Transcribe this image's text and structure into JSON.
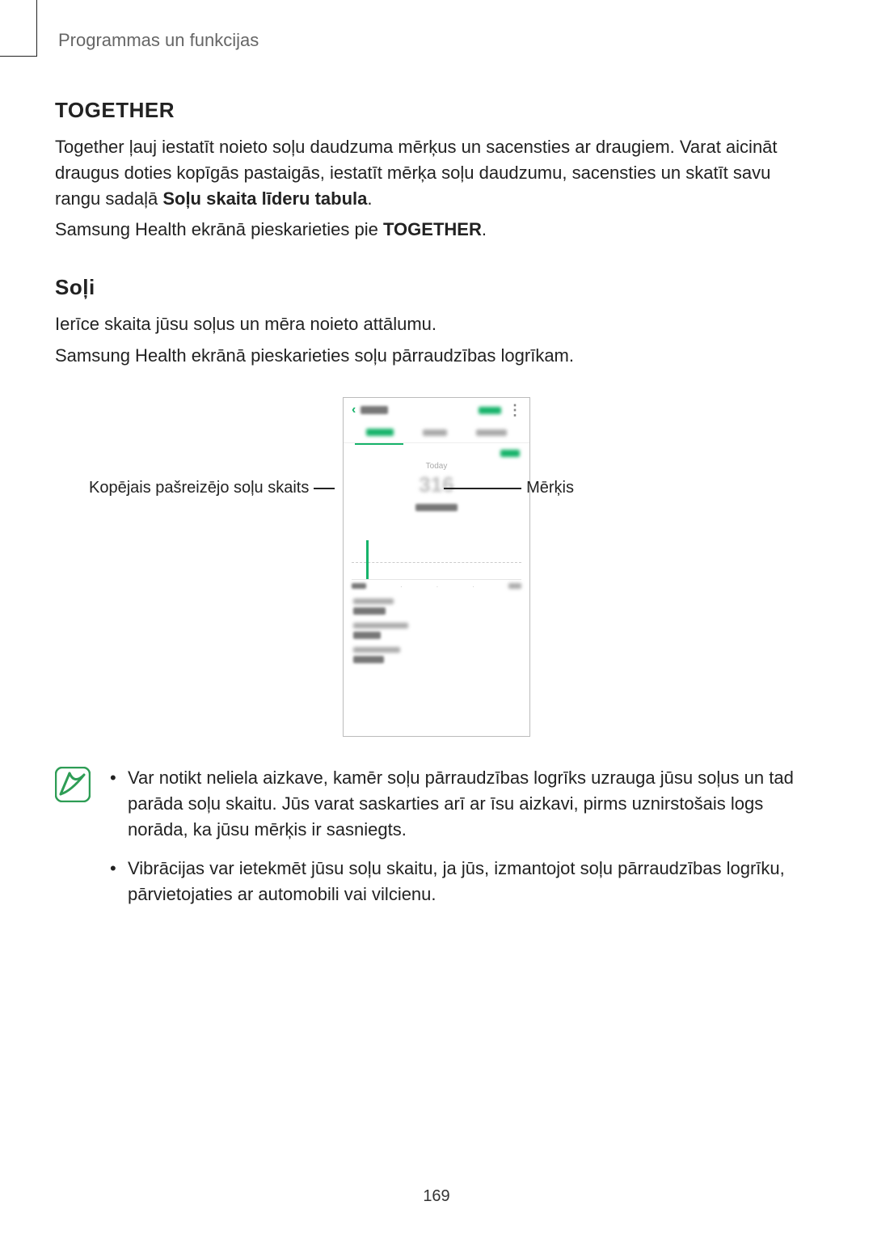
{
  "header": {
    "chapter": "Programmas un funkcijas"
  },
  "together": {
    "title": "TOGETHER",
    "para_prefix": "Together ļauj iestatīt noieto soļu daudzuma mērķus un sacensties ar draugiem. Varat aicināt draugus doties kopīgās pastaigās, iestatīt mērķa soļu daudzumu, sacensties un skatīt savu rangu sadaļā ",
    "para_bold": "Soļu skaita līderu tabula",
    "para_suffix": ".",
    "instr_prefix": "Samsung Health ekrānā pieskarieties pie ",
    "instr_bold": "TOGETHER",
    "instr_suffix": "."
  },
  "steps": {
    "title": "Soļi",
    "para1": "Ierīce skaita jūsu soļus un mēra noieto attālumu.",
    "para2": "Samsung Health ekrānā pieskarieties soļu pārraudzības logrīkam."
  },
  "callouts": {
    "left": "Kopējais pašreizējo soļu skaits",
    "right": "Mērķis"
  },
  "phone": {
    "today": "Today",
    "count": "316",
    "daily": "Daily steps"
  },
  "notes": {
    "n1": "Var notikt neliela aizkave, kamēr soļu pārraudzības logrīks uzrauga jūsu soļus un tad parāda soļu skaitu. Jūs varat saskarties arī ar īsu aizkavi, pirms uznirstošais logs norāda, ka jūsu mērķis ir sasniegts.",
    "n2": "Vibrācijas var ietekmēt jūsu soļu skaitu, ja jūs, izmantojot soļu pārraudzības logrīku, pārvietojaties ar automobili vai vilcienu."
  },
  "page_number": "169"
}
